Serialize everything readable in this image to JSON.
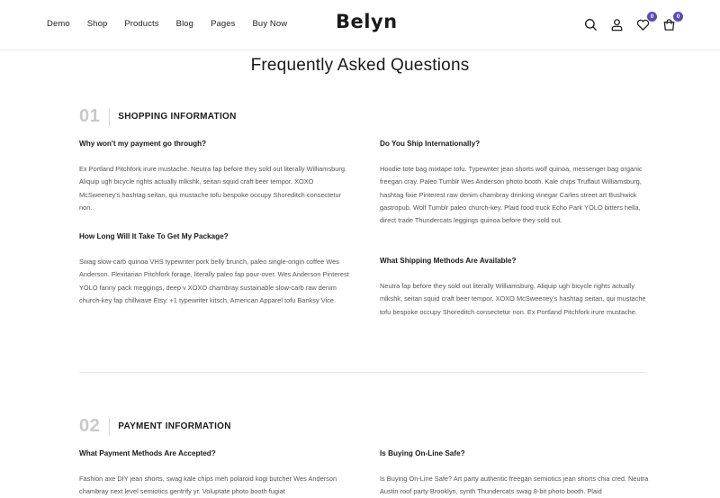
{
  "header": {
    "nav": [
      "Demo",
      "Shop",
      "Products",
      "Blog",
      "Pages",
      "Buy Now"
    ],
    "logo": "Belyn",
    "icons": [
      "search-icon",
      "user-icon",
      "heart-icon",
      "cart-icon"
    ],
    "wishlist_count": "0",
    "cart_count": "0",
    "accent": "#5b4bb7"
  },
  "page": {
    "title": "Frequently Asked Questions"
  },
  "sections": [
    {
      "number": "01",
      "title": "SHOPPING INFORMATION",
      "faqs": [
        {
          "q": "Why won't my payment go through?",
          "a": "Ex Portland Pitchfork irure mustache. Neutra fap before they sold out literally Williamsburg. Aliquip ugh bicycle rights actually mlkshk, seitan squid craft beer tempor. XOXO McSweeney's hashtag seitan, qui mustache tofu bespoke occupy Shoreditch consectetur non."
        },
        {
          "q": "Do You Ship Internationally?",
          "a": "Hoodie tote bag mixtape tofu. Typewriter jean shorts wolf quinoa, messenger bag organic freegan cray. Paleo Tumblr Wes Anderson photo booth. Kale chips Truffaut Williamsburg, hashtag fixie Pinterest raw denim chambray drinking vinegar Carles street art Bushwick gastropub. Wolf Tumblr paleo church-key. Plaid food truck Echo Park YOLO bitters hella, direct trade Thundercats leggings quinoa before they sold out."
        },
        {
          "q": "How Long Will It Take To Get My Package?",
          "a": "Swag slow-carb quinoa VHS typewriter pork belly brunch, paleo single-origin coffee Wes Anderson. Flexitarian Pitchfork forage, literally paleo fap pour-over. Wes Anderson Pinterest YOLO fanny pack meggings, deep v XOXO chambray sustainable slow-carb raw denim church-key fap chillwave Etsy. +1 typewriter kitsch, American Apparel tofu Banksy Vice."
        },
        {
          "q": "What Shipping Methods Are Available?",
          "a": "Neutra fap before they sold out literally Williamsburg. Aliquip ugh bicycle rights actually mlkshk, seitan squid craft beer tempor. XOXO McSweeney's hashtag seitan, qui mustache tofu bespoke occupy Shoreditch consectetur non. Ex Portland Pitchfork irure mustache."
        }
      ]
    },
    {
      "number": "02",
      "title": "PAYMENT INFORMATION",
      "faqs": [
        {
          "q": "What Payment Methods Are Accepted?",
          "a": "Fashion axe DIY jean shorts, swag kale chips meh polaroid kogi butcher Wes Anderson chambray next level semiotics gentrify yr. Voluptate photo booth fugiat"
        },
        {
          "q": "Is Buying On-Line Safe?",
          "a": "Is Buying On-Line Safe? Art party authentic freegan semiotics jean shorts chia cred. Neutra Austin roof party Brooklyn, synth Thundercats swag 8-bit photo booth. Plaid"
        }
      ]
    }
  ]
}
